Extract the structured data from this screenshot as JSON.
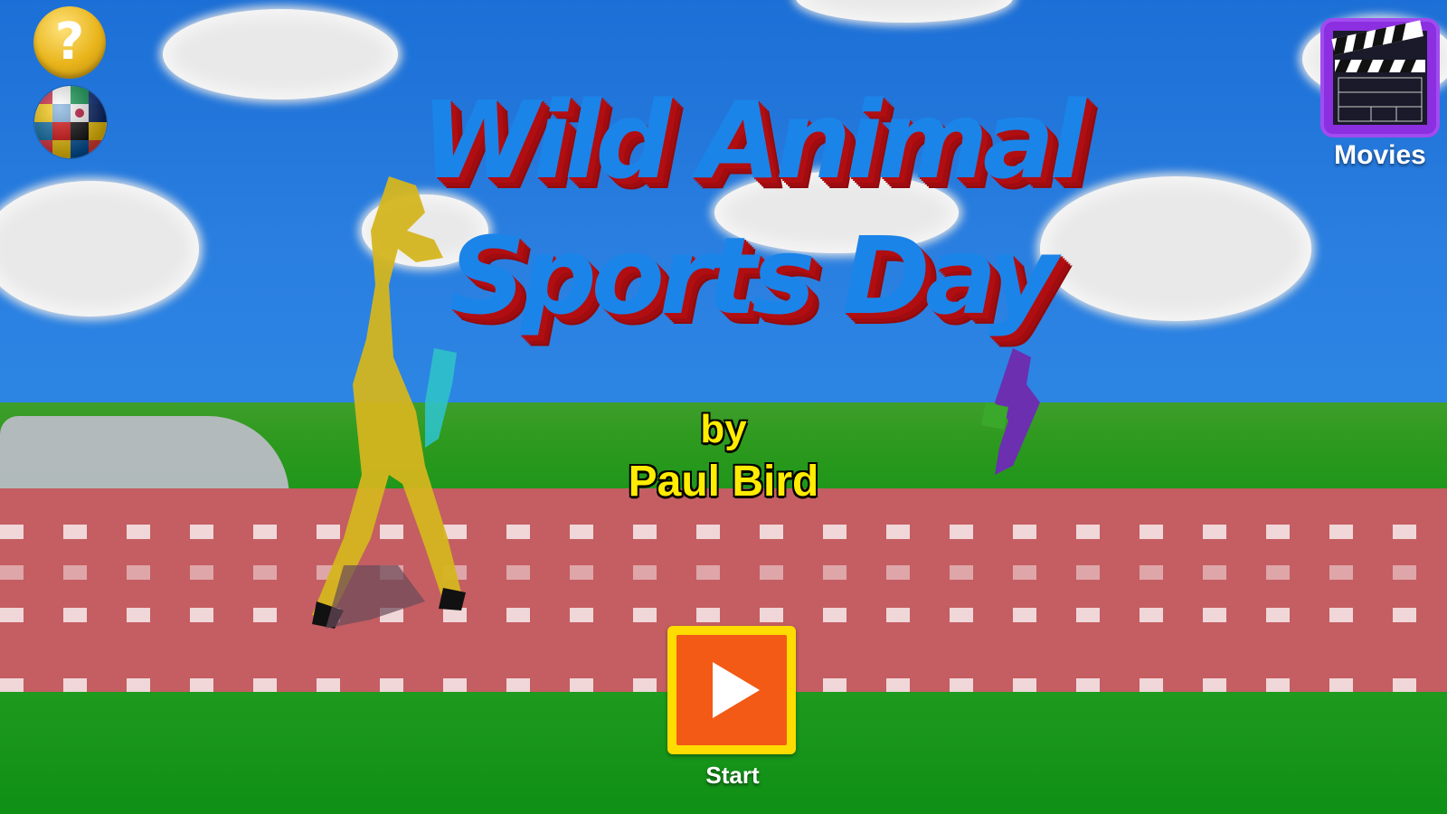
{
  "game": {
    "title_line1": "Wild Animal",
    "title_line2": "Sports Day",
    "byline_by": "by",
    "byline_author": "Paul Bird"
  },
  "controls": {
    "help_symbol": "?",
    "help_icon": "question-mark-icon",
    "language_icon": "world-flags-globe-icon",
    "movies_icon": "clapperboard-icon",
    "movies_label": "Movies",
    "start_icon": "play-icon",
    "start_label": "Start"
  },
  "colors": {
    "title_face": "#1b84e8",
    "title_extrude": "#b10e12",
    "byline": "#ffec00",
    "start_frame": "#ffdc00",
    "start_fill": "#f25a15",
    "movies_frame": "#8b2fe0",
    "sky": "#2a7fe0",
    "track": "#c45e62",
    "grass": "#1e961a"
  }
}
